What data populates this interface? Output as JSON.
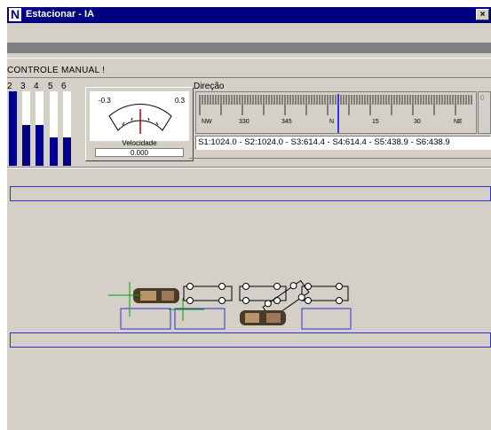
{
  "window": {
    "title": "Estacionar - IA",
    "icon": "app-n-icon",
    "close_glyph": "×"
  },
  "status_text": "CONTROLE MANUAL !",
  "bar_chart": {
    "labels": [
      "2",
      "3",
      "4",
      "5",
      "6"
    ],
    "levels": [
      1.0,
      0.55,
      0.55,
      0.38,
      0.38
    ]
  },
  "velocity_gauge": {
    "min_label": "-0.3",
    "max_label": "0.3",
    "caption": "Velocidade",
    "value": "0.000"
  },
  "direction": {
    "label": "Direção",
    "tick_labels": [
      "NW",
      "330",
      "345",
      "N",
      "15",
      "30",
      "NE"
    ]
  },
  "sensor_readout": "S1:1024.0 - S2:1024.0 - S3:614.4 - S4:614.4 - S5:438.9 - S6:438.9",
  "right_mini_label": "0",
  "colors": {
    "title_bar": "#000080",
    "bar_fill": "#00008b",
    "needle": "#c00000",
    "lane_border": "#3030d0",
    "marker": "#00a000"
  }
}
